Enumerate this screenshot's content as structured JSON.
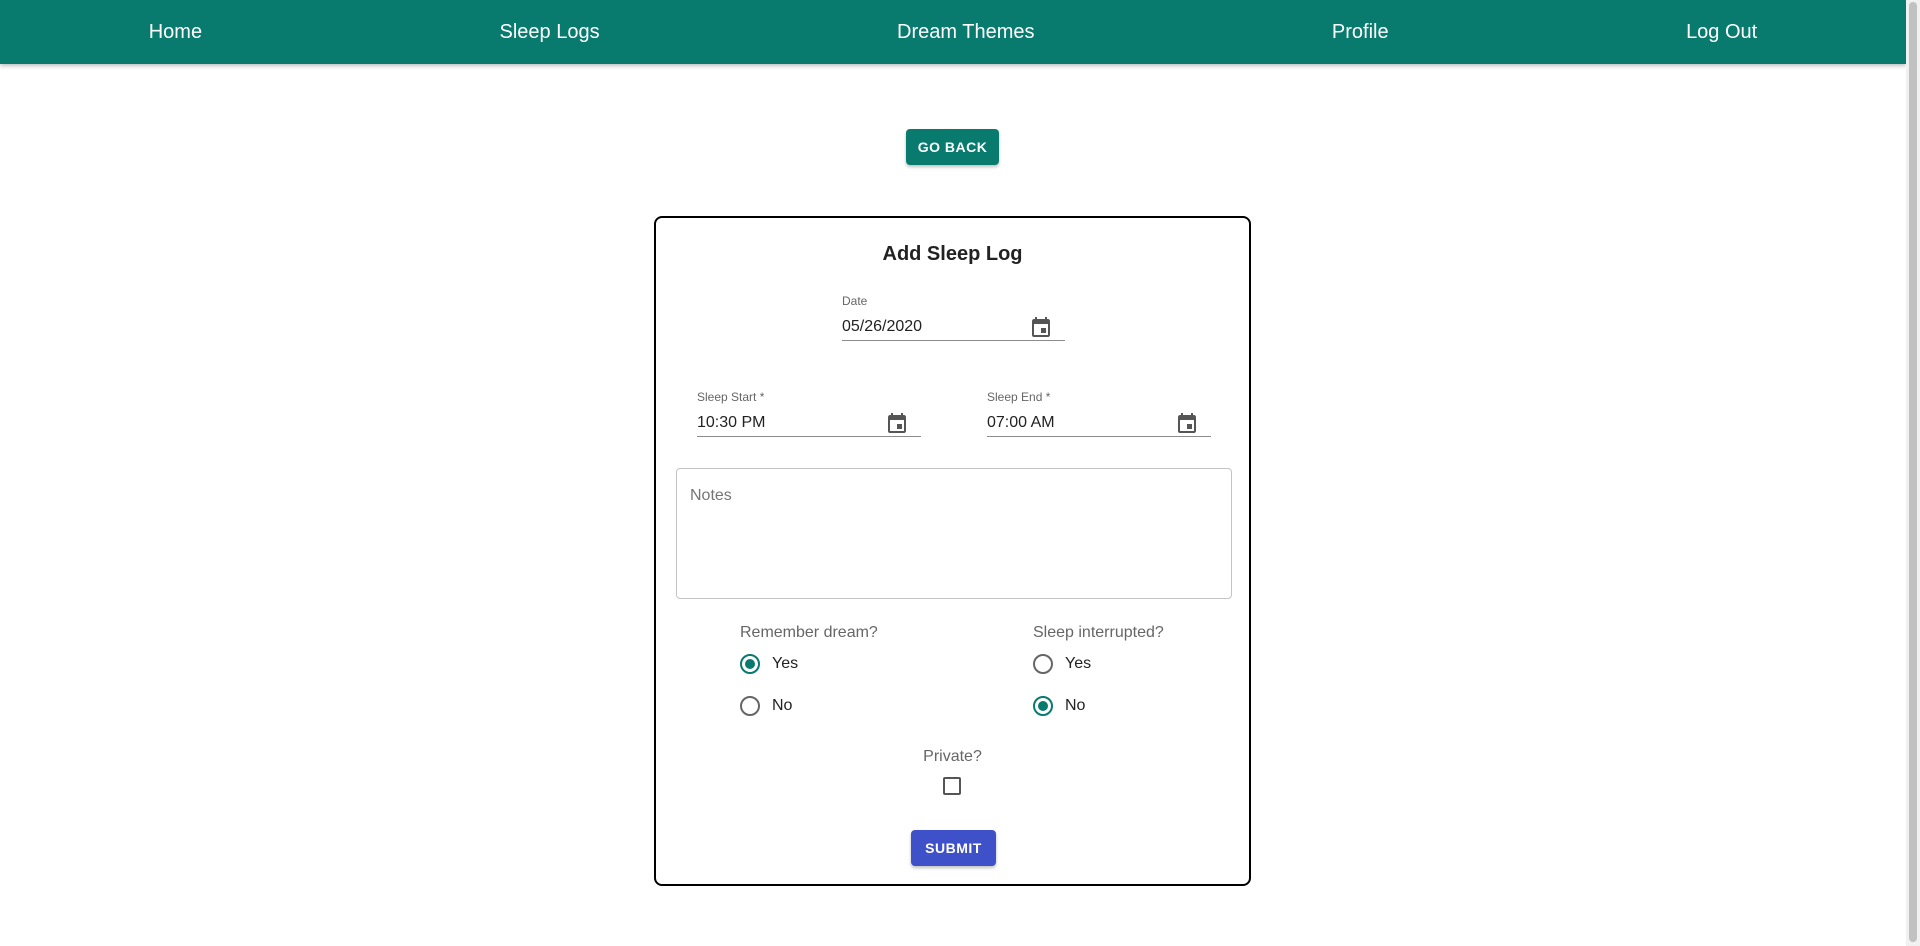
{
  "nav": {
    "items": [
      {
        "label": "Home"
      },
      {
        "label": "Sleep Logs"
      },
      {
        "label": "Dream Themes"
      },
      {
        "label": "Profile"
      },
      {
        "label": "Log Out"
      }
    ]
  },
  "go_back_label": "GO BACK",
  "form": {
    "title": "Add Sleep Log",
    "date": {
      "label": "Date",
      "value": "05/26/2020"
    },
    "sleep_start": {
      "label": "Sleep Start *",
      "value": "10:30 PM"
    },
    "sleep_end": {
      "label": "Sleep End *",
      "value": "07:00 AM"
    },
    "notes": {
      "placeholder": "Notes",
      "value": ""
    },
    "remember_dream": {
      "label": "Remember dream?",
      "options": [
        {
          "label": "Yes",
          "checked": true
        },
        {
          "label": "No",
          "checked": false
        }
      ]
    },
    "sleep_interrupted": {
      "label": "Sleep interrupted?",
      "options": [
        {
          "label": "Yes",
          "checked": false
        },
        {
          "label": "No",
          "checked": true
        }
      ]
    },
    "private": {
      "label": "Private?",
      "checked": false
    },
    "submit_label": "SUBMIT"
  },
  "colors": {
    "appbar": "#087a6e",
    "primary": "#087a6e",
    "submit": "#3f51c8"
  },
  "icons": {
    "date_picker": "calendar-icon"
  }
}
